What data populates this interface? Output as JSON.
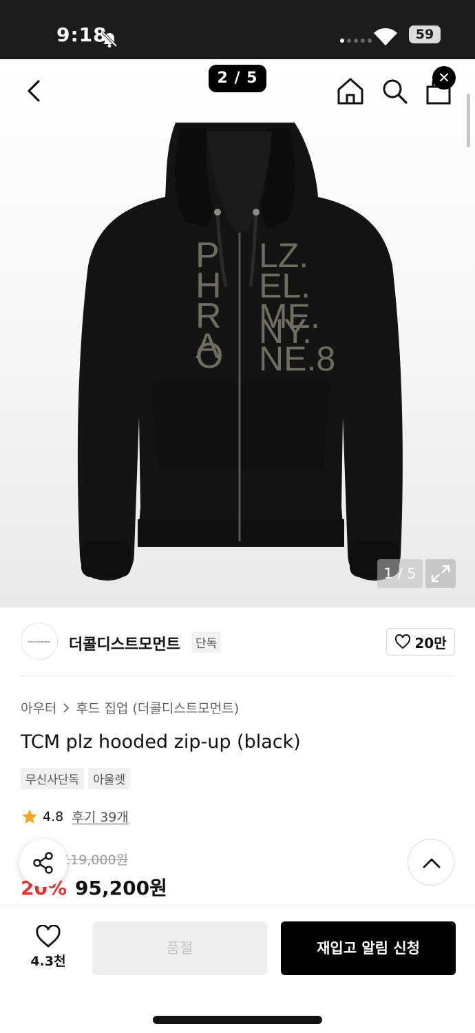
{
  "status_bar": {
    "time": "9:18",
    "battery": "59"
  },
  "header": {
    "page_indicator": "2 / 5"
  },
  "gallery": {
    "counter": "1 / 5",
    "print_lines_left": [
      "P",
      "H",
      "R",
      "A",
      "O"
    ],
    "print_lines_right": [
      "LZ.",
      "EL.",
      "ME.",
      "NY.",
      "NE.8"
    ]
  },
  "brand": {
    "logo_text": "THECOLDISTMOMENT",
    "name": "더콜디스트모먼트",
    "badge": "단독",
    "likes": "20만"
  },
  "product": {
    "breadcrumb": [
      "아우터",
      "후드 집업 (더콜디스트모먼트)"
    ],
    "title": "TCM plz hooded zip-up (black)",
    "tags": [
      "무신사단독",
      "아울렛"
    ],
    "rating": "4.8",
    "review_link": "후기 39개",
    "original_price": "119,000원",
    "discount": "20%",
    "sale_price": "95,200원"
  },
  "bottom_bar": {
    "wish_count": "4.3천",
    "soldout_label": "품절",
    "restock_label": "재입고 알림 신청"
  },
  "colors": {
    "accent_red": "#e53434",
    "star": "#f5a623",
    "primary": "#000000"
  }
}
